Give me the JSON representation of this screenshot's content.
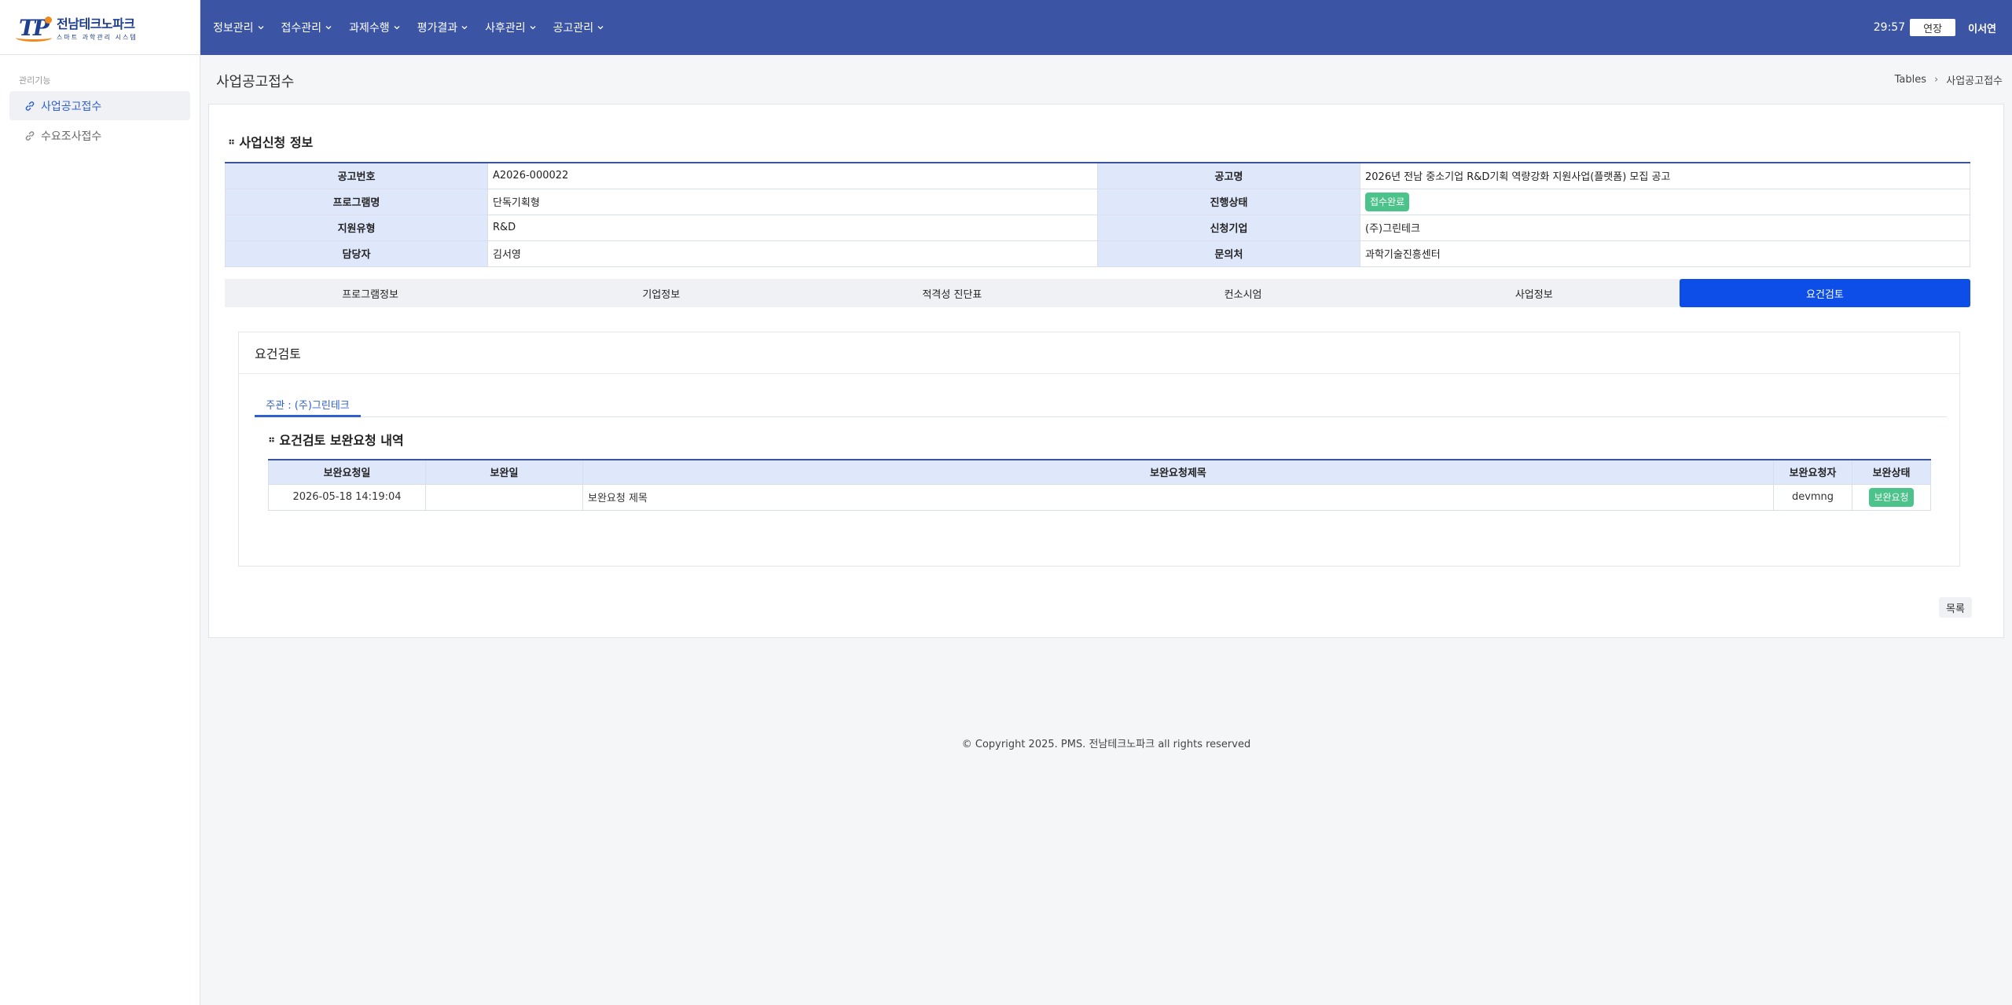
{
  "logo": {
    "title": "전남테크노파크",
    "subtitle": "스마트 과학관리 시스템"
  },
  "sidebar": {
    "group_label": "관리기능",
    "items": [
      {
        "label": "사업공고접수",
        "active": true
      },
      {
        "label": "수요조사접수",
        "active": false
      }
    ]
  },
  "topnav": {
    "menus": [
      "정보관리",
      "접수관리",
      "과제수행",
      "평가결과",
      "사후관리",
      "공고관리"
    ],
    "timer": "29:57",
    "extend_label": "연장",
    "username": "이서연"
  },
  "page": {
    "title": "사업공고접수",
    "breadcrumb": {
      "root": "Tables",
      "current": "사업공고접수"
    }
  },
  "application_info": {
    "section_title": "사업신청 정보",
    "rows": [
      {
        "l1": "공고번호",
        "v1": "A2026-000022",
        "l2": "공고명",
        "v2": "2026년 전남 중소기업 R&D기획 역량강화 지원사업(플랫폼) 모집 공고"
      },
      {
        "l1": "프로그램명",
        "v1": "단독기획형",
        "l2": "진행상태",
        "v2": "접수완료"
      },
      {
        "l1": "지원유형",
        "v1": "R&D",
        "l2": "신청기업",
        "v2": "(주)그린테크"
      },
      {
        "l1": "담당자",
        "v1": "김서영",
        "l2": "문의처",
        "v2": "과학기술진흥센터"
      }
    ]
  },
  "tabs": [
    "프로그램정보",
    "기업정보",
    "적격성 진단표",
    "컨소시엄",
    "사업정보",
    "요건검토"
  ],
  "active_tab_index": 5,
  "requirement_review": {
    "header": "요건검토",
    "subtab": "주관 : (주)그린테크",
    "section_title": "요건검토 보완요청 내역",
    "columns": [
      "보완요청일",
      "보완일",
      "보완요청제목",
      "보완요청자",
      "보완상태"
    ],
    "rows": [
      {
        "request_date": "2026-05-18 14:19:04",
        "complete_date": "",
        "title": "보완요청 제목",
        "requester": "devmng",
        "status": "보완요청"
      }
    ]
  },
  "list_button": "목록",
  "footer": "© Copyright 2025. PMS. 전남테크노파크 all rights reserved",
  "colors": {
    "nav": "#3b54a3",
    "active_tab": "#0d4ee8",
    "badge": "#4cc38a",
    "label_bg": "#dfe8fb"
  }
}
